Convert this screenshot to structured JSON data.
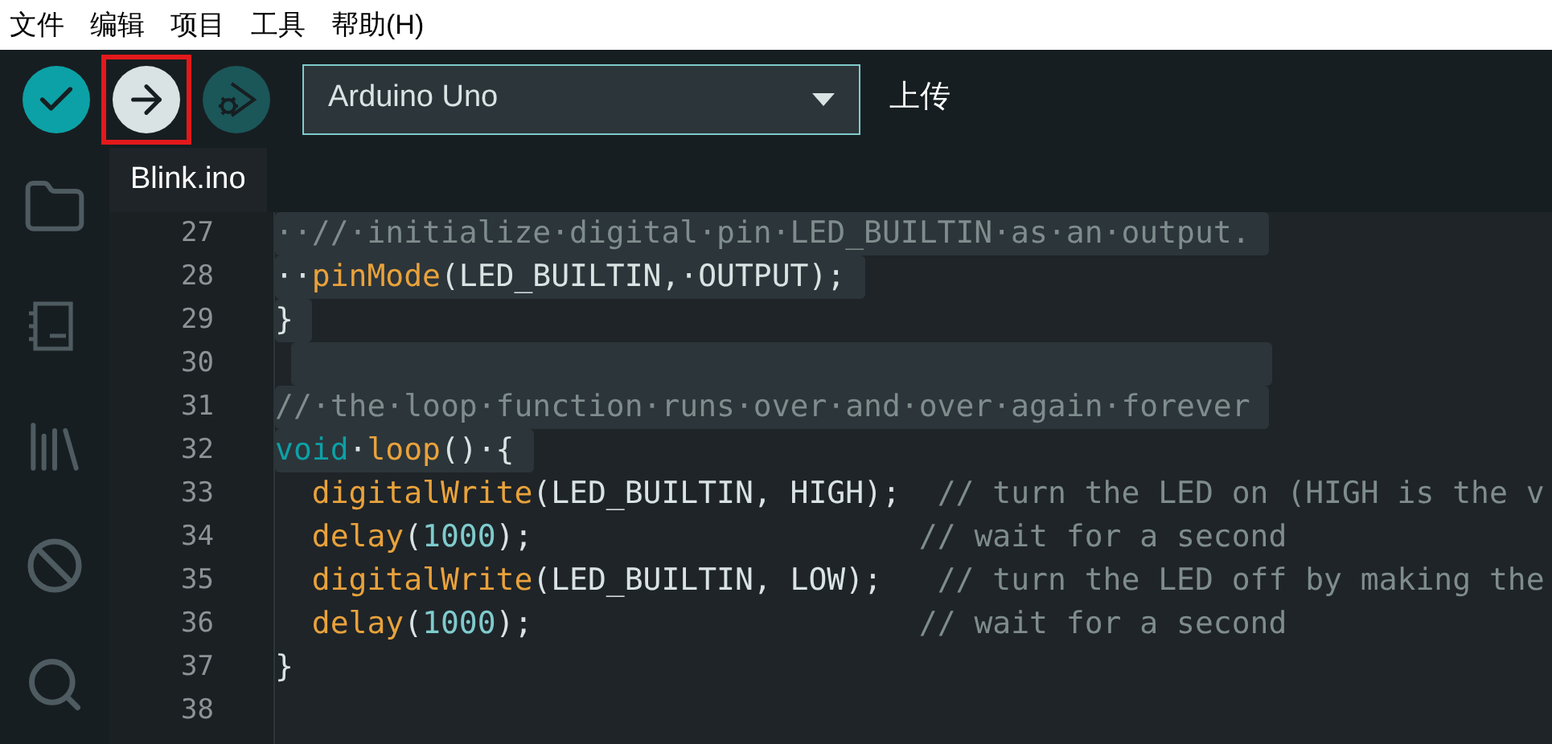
{
  "menu": [
    "文件",
    "编辑",
    "项目",
    "工具",
    "帮助(H)"
  ],
  "toolbar": {
    "buttons": [
      {
        "kind": "verify",
        "highlighted": false,
        "disabled": false
      },
      {
        "kind": "upload",
        "highlighted": true,
        "disabled": false
      },
      {
        "kind": "debug",
        "highlighted": false,
        "disabled": true
      }
    ],
    "board": "Arduino Uno",
    "tooltip": "上传"
  },
  "sidebar": [
    {
      "kind": "folder",
      "selected": false
    },
    {
      "kind": "board",
      "selected": false
    },
    {
      "kind": "library",
      "selected": false
    },
    {
      "kind": "debug",
      "selected": false
    },
    {
      "kind": "search",
      "selected": false
    }
  ],
  "tabs": [
    {
      "label": "Blink.ino",
      "selected": true
    }
  ],
  "lines": [
    {
      "number": "27",
      "selected": true,
      "tokens": [
        {
          "kind": "comment",
          "text": "··//·initialize·digital·pin·LED_BUILTIN·as·an·output."
        }
      ]
    },
    {
      "number": "28",
      "selected": true,
      "tokens": [
        {
          "kind": "plain",
          "text": "··"
        },
        {
          "kind": "function",
          "text": "pinMode"
        },
        {
          "kind": "plain",
          "text": "(LED_BUILTIN,·OUTPUT);"
        }
      ]
    },
    {
      "number": "29",
      "selected": true,
      "tokens": [
        {
          "kind": "plain",
          "text": "}"
        }
      ]
    },
    {
      "number": "30",
      "selected": true
    },
    {
      "number": "31",
      "selected": true,
      "tokens": [
        {
          "kind": "comment",
          "text": "//·the·loop·function·runs·over·and·over·again·forever"
        }
      ]
    },
    {
      "number": "32",
      "selected": true,
      "tokens": [
        {
          "kind": "keyword",
          "text": "void"
        },
        {
          "kind": "plain",
          "text": "·"
        },
        {
          "kind": "function",
          "text": "loop"
        },
        {
          "kind": "plain",
          "text": "()·{"
        }
      ]
    },
    {
      "number": "33",
      "selected": false,
      "tokens": [
        {
          "kind": "function",
          "text": "  digitalWrite"
        },
        {
          "kind": "plain",
          "text": "(LED_BUILTIN, HIGH);  "
        },
        {
          "kind": "comment",
          "text": "// turn the LED on (HIGH is the v"
        }
      ]
    },
    {
      "number": "34",
      "selected": false,
      "tokens": [
        {
          "kind": "function",
          "text": "  delay"
        },
        {
          "kind": "plain",
          "text": "("
        },
        {
          "kind": "number",
          "text": "1000"
        },
        {
          "kind": "plain",
          "text": ");                     "
        },
        {
          "kind": "comment",
          "text": "// wait for a second"
        }
      ]
    },
    {
      "number": "35",
      "selected": false,
      "tokens": [
        {
          "kind": "function",
          "text": "  digitalWrite"
        },
        {
          "kind": "plain",
          "text": "(LED_BUILTIN, LOW);   "
        },
        {
          "kind": "comment",
          "text": "// turn the LED off by making the"
        }
      ]
    },
    {
      "number": "36",
      "selected": false,
      "tokens": [
        {
          "kind": "function",
          "text": "  delay"
        },
        {
          "kind": "plain",
          "text": "("
        },
        {
          "kind": "number",
          "text": "1000"
        },
        {
          "kind": "plain",
          "text": ");                     "
        },
        {
          "kind": "comment",
          "text": "// wait for a second"
        }
      ]
    },
    {
      "number": "37",
      "selected": false,
      "tokens": [
        {
          "kind": "plain",
          "text": "}"
        }
      ]
    },
    {
      "number": "38",
      "selected": false
    }
  ]
}
